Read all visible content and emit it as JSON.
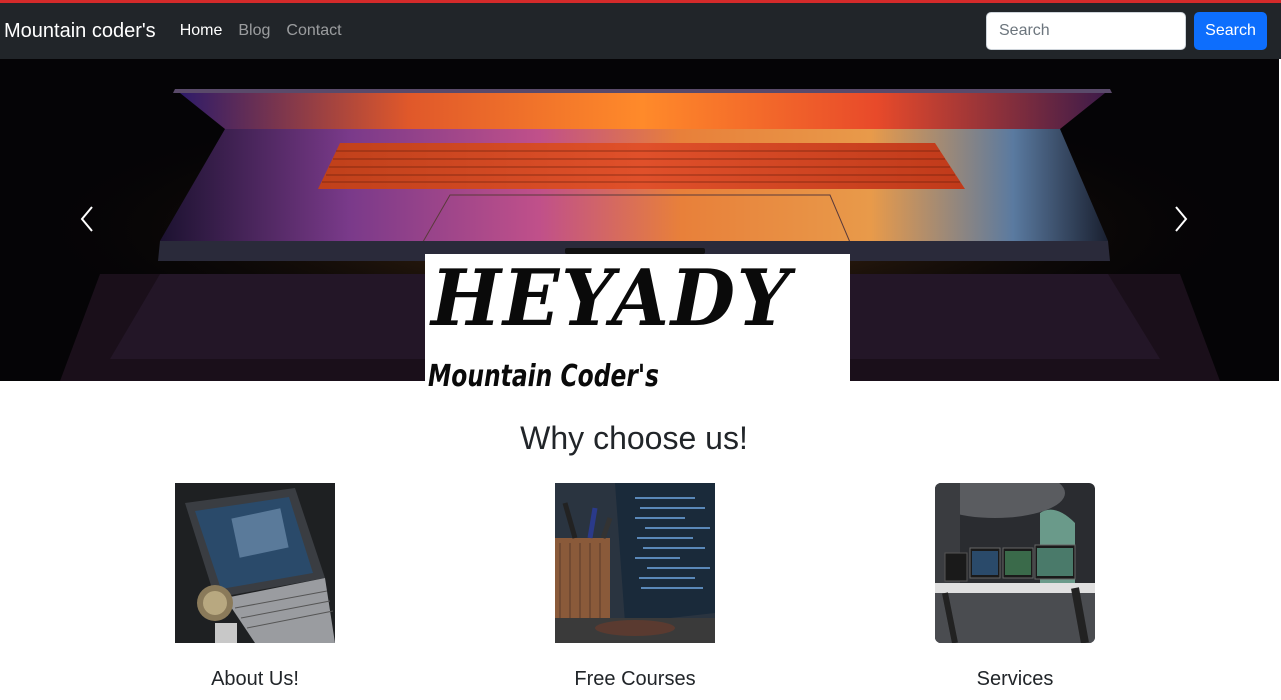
{
  "navbar": {
    "brand": "Mountain coder's",
    "links": [
      {
        "label": "Home",
        "active": true
      },
      {
        "label": "Blog",
        "active": false
      },
      {
        "label": "Contact",
        "active": false
      }
    ],
    "search": {
      "placeholder": "Search",
      "button_label": "Search"
    }
  },
  "hero": {
    "image": "laptop-glowing-keyboard-photo",
    "prev_icon": "chevron-left-icon",
    "next_icon": "chevron-right-icon"
  },
  "logo": {
    "title": "HEYADY",
    "subtitle": "Mountain Coder's"
  },
  "main": {
    "heading": "Why choose us!",
    "features": [
      {
        "title": "About Us!",
        "image": "laptop-desk-photo"
      },
      {
        "title": "Free Courses",
        "image": "code-screen-pencils-photo"
      },
      {
        "title": "Services",
        "image": "office-monitors-photo"
      }
    ]
  },
  "colors": {
    "navbar_bg": "#212529",
    "accent_blue": "#0d6efd",
    "top_strip": "#d42a2a"
  }
}
